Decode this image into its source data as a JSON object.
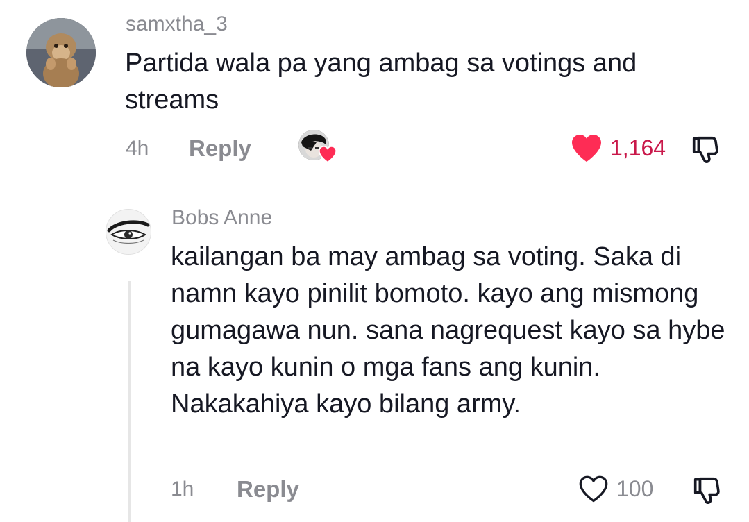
{
  "comment": {
    "username": "samxtha_3",
    "text": "Partida wala pa yang ambag sa votings and streams",
    "time": "4h",
    "reply_label": "Reply",
    "like_count": "1,164",
    "liked": true,
    "creator_liked": true,
    "avatar_icon": "monkey-avatar",
    "heart_color": "#fe2c55"
  },
  "reply": {
    "username": "Bobs Anne",
    "text": "kailangan ba may ambag sa voting. Saka di namn kayo pinilit bomoto. kayo ang mismong gumagawa nun. sana nagrequest kayo sa hybe na kayo kunin o mga fans ang kunin. Nakakahiya kayo bilang army.",
    "time": "1h",
    "reply_label": "Reply",
    "like_count": "100",
    "liked": false,
    "avatar_icon": "eye-sketch-avatar"
  },
  "colors": {
    "username": "#8a8b91",
    "text": "#161823",
    "like_active": "#c9184a",
    "heart_fill": "#fe2c55",
    "thread_line": "#e6e6e6"
  }
}
